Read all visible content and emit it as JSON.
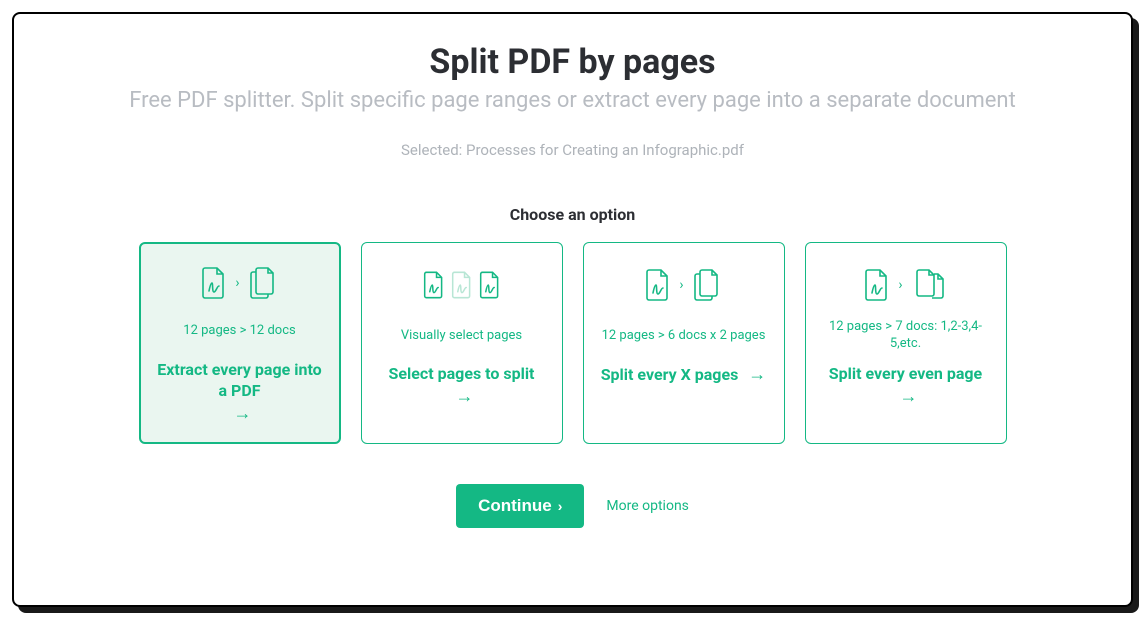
{
  "title": "Split PDF by pages",
  "subtitle": "Free PDF splitter. Split specific page ranges or extract every page into a separate document",
  "selected_prefix": "Selected: ",
  "selected_file": "Processes for Creating an Infographic.pdf",
  "choose_label": "Choose an option",
  "cards": [
    {
      "meta": "12 pages > 12 docs",
      "title": "Extract every page into a PDF"
    },
    {
      "meta": "Visually select pages",
      "title": "Select pages to split"
    },
    {
      "meta": "12 pages > 6 docs x 2 pages",
      "title": "Split every X pages"
    },
    {
      "meta": "12 pages > 7 docs: 1,2-3,4-5,etc.",
      "title": "Split every even page"
    }
  ],
  "continue_label": "Continue",
  "more_options": "More options"
}
